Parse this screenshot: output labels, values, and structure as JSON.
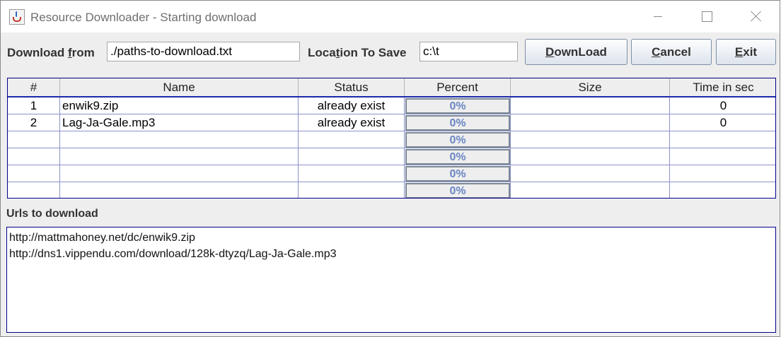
{
  "window": {
    "title": "Resource Downloader - Starting download"
  },
  "toolbar": {
    "download_from_label": "Download from",
    "download_from_value": "./paths-to-download.txt",
    "location_label": "Location To Save",
    "location_value": "c:\\t",
    "download_button": "DownLoad",
    "cancel_button": "Cancel",
    "exit_button": "Exit"
  },
  "table": {
    "columns": [
      "#",
      "Name",
      "Status",
      "Percent",
      "Size",
      "Time in sec"
    ],
    "rows": [
      {
        "num": "1",
        "name": "enwik9.zip",
        "status": "already exist",
        "percent": "0%",
        "progress": 0,
        "size": "",
        "time": "0"
      },
      {
        "num": "2",
        "name": "Lag-Ja-Gale.mp3",
        "status": "already exist",
        "percent": "0%",
        "progress": 0,
        "size": "",
        "time": "0"
      },
      {
        "num": "",
        "name": "",
        "status": "",
        "percent": "0%",
        "progress": 0,
        "size": "",
        "time": ""
      },
      {
        "num": "",
        "name": "",
        "status": "",
        "percent": "0%",
        "progress": 0,
        "size": "",
        "time": ""
      },
      {
        "num": "",
        "name": "",
        "status": "",
        "percent": "0%",
        "progress": 0,
        "size": "",
        "time": ""
      },
      {
        "num": "",
        "name": "",
        "status": "",
        "percent": "0%",
        "progress": 0,
        "size": "",
        "time": ""
      }
    ]
  },
  "urls": {
    "label": "Urls to download",
    "lines": [
      "http://mattmahoney.net/dc/enwik9.zip",
      "http://dns1.vippendu.com/download/128k-dtyzq/Lag-Ja-Gale.mp3"
    ]
  }
}
